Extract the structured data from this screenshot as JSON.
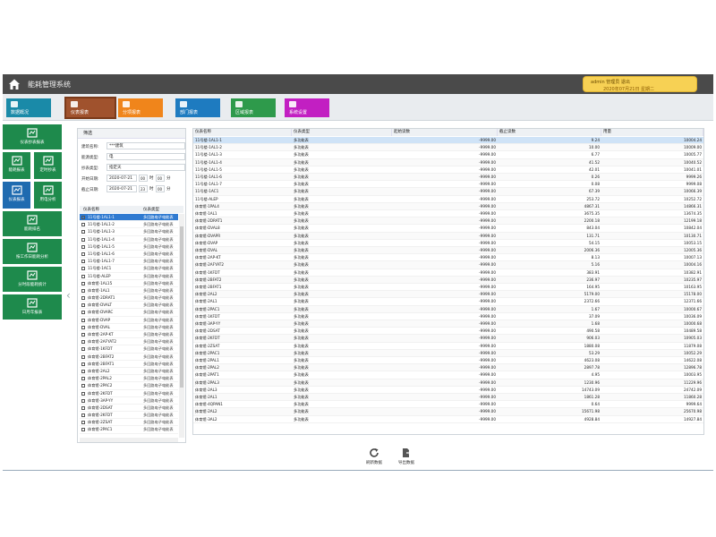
{
  "header": {
    "title": "能耗管理系统",
    "user_line": "admin 管理员  退出",
    "date_line": "2020年07月21日 星期二"
  },
  "tabs": [
    {
      "label": "数据概况",
      "color": "#1a8aa8"
    },
    {
      "label": "仪表报表",
      "color": "#a0522d"
    },
    {
      "label": "分项报表",
      "color": "#f0851b"
    },
    {
      "label": "部门报表",
      "color": "#1e7bc0"
    },
    {
      "label": "区域报表",
      "color": "#2e9a4b"
    },
    {
      "label": "系统设置",
      "color": "#c21fc2"
    }
  ],
  "leftnav": [
    {
      "label": "仪表抄表报表",
      "icon": "book-icon"
    },
    {
      "label": "能耗报表",
      "icon": "chart-icon"
    },
    {
      "label": "定时抄表",
      "icon": "clock-icon"
    },
    {
      "label": "仪表报表",
      "icon": "meter-icon"
    },
    {
      "label": "用电分析",
      "icon": "doc-icon"
    },
    {
      "label": "能耗排名",
      "icon": "rank-icon"
    },
    {
      "label": "按工作日能耗分析",
      "icon": "calendar-icon"
    },
    {
      "label": "分时段能耗统计",
      "icon": "target-icon"
    },
    {
      "label": "日月年报表",
      "icon": "sheet-icon"
    }
  ],
  "filter": {
    "title": "筛选",
    "fields": [
      {
        "label": "建筑名称:",
        "value": "***建筑"
      },
      {
        "label": "能源类型:",
        "value": "电"
      },
      {
        "label": "抄表类型:",
        "value": "指定天"
      },
      {
        "label": "开始日期:",
        "value": "2020-07-21"
      },
      {
        "label": "截止日期:",
        "value": "2020-07-21"
      }
    ],
    "time_hour_start": "00",
    "time_min_start": "00",
    "time_hour_end": "23",
    "time_min_end": "00",
    "time_unit_h": "时",
    "time_unit_m": "分",
    "col_name": "仪表名称",
    "col_type": "仪表类型",
    "items": [
      "11号楼-1AL1-1",
      "11号楼-1AL1-2",
      "11号楼-1AL1-3",
      "11号楼-1AL1-4",
      "11号楼-1AL1-5",
      "11号楼-1AL1-6",
      "11号楼-1AL1-7",
      "11号楼-1AC1",
      "11号楼-ALEP",
      "体育馆-1AL15",
      "体育馆-1AL1",
      "体育馆-2DRAT1",
      "体育馆-DVALT",
      "体育馆-DVARC",
      "体育馆-DVAP",
      "体育馆-DVAL",
      "体育馆-2AP-KT",
      "体育馆-2AFYAT2",
      "体育馆-1KFDT",
      "体育馆-2BFAT2",
      "体育馆-2BFAT1",
      "体育馆-2AL2",
      "体育馆-2PAL2",
      "体育馆-2PAC2",
      "体育馆-2KFDT",
      "体育馆-3AP-YY",
      "体育馆-2DSAT",
      "体育馆-2KFDT",
      "体育馆-2ZSAT",
      "体育馆-2PAC1"
    ],
    "item_type": "多回路电子电能表"
  },
  "grid": {
    "columns": [
      "仪表名称",
      "仪表类型",
      "起始读数",
      "截止读数",
      "用量"
    ],
    "type_value": "多功能表",
    "rows": [
      [
        "11号楼-1AL1-1",
        "-9999.00",
        "9.24",
        "10004.24"
      ],
      [
        "11号楼-1AL1-2",
        "-9999.00",
        "10.00",
        "10009.00"
      ],
      [
        "11号楼-1AL1-3",
        "-9999.00",
        "6.77",
        "10005.77"
      ],
      [
        "11号楼-1AL1-4",
        "-9999.00",
        "41.52",
        "10040.52"
      ],
      [
        "11号楼-1AL1-5",
        "-9999.00",
        "42.01",
        "10041.01"
      ],
      [
        "11号楼-1AL1-6",
        "-9999.00",
        "0.26",
        "9999.26"
      ],
      [
        "11号楼-1AL1-7",
        "-9999.00",
        "0.08",
        "9999.08"
      ],
      [
        "11号楼-1AC1",
        "-9999.00",
        "67.39",
        "10066.39"
      ],
      [
        "11号楼-ALEP",
        "-9999.00",
        "253.72",
        "10252.72"
      ],
      [
        "体育馆-1PAL4",
        "-9999.00",
        "4867.31",
        "14866.31"
      ],
      [
        "体育馆-1AL1",
        "-9999.00",
        "3675.35",
        "13674.35"
      ],
      [
        "体育馆-2DRAT1",
        "-9999.00",
        "2200.18",
        "12199.18"
      ],
      [
        "体育馆-DVAL8",
        "-9999.00",
        "843.04",
        "10842.04"
      ],
      [
        "体育馆-DVAPR",
        "-9999.00",
        "131.71",
        "10130.71"
      ],
      [
        "体育馆-DVAP",
        "-9999.00",
        "54.15",
        "10053.15"
      ],
      [
        "体育馆-DVAL",
        "-9999.00",
        "2006.36",
        "12005.36"
      ],
      [
        "体育馆-2AP-KT",
        "-9999.00",
        "8.13",
        "10007.13"
      ],
      [
        "体育馆-2AFYAT2",
        "-9999.00",
        "5.16",
        "10004.16"
      ],
      [
        "体育馆-1KFDT",
        "-9999.00",
        "383.91",
        "10382.91"
      ],
      [
        "体育馆-2BFAT2",
        "-9999.00",
        "236.97",
        "10235.97"
      ],
      [
        "体育馆-2BFAT1",
        "-9999.00",
        "164.95",
        "10163.95"
      ],
      [
        "体育馆-2AL2",
        "-9999.00",
        "5179.00",
        "15178.00"
      ],
      [
        "体育馆-2AL1",
        "-9999.00",
        "2372.66",
        "12371.66"
      ],
      [
        "体育馆-2PAC1",
        "-9999.00",
        "1.67",
        "10000.67"
      ],
      [
        "体育馆-1KFDT",
        "-9999.00",
        "37.09",
        "10036.09"
      ],
      [
        "体育馆-3AP-YY",
        "-9999.00",
        "1.68",
        "10000.68"
      ],
      [
        "体育馆-2DSAT",
        "-9999.00",
        "490.58",
        "10489.58"
      ],
      [
        "体育馆-2KFDT",
        "-9999.00",
        "906.03",
        "10905.03"
      ],
      [
        "体育馆-2ZSAT",
        "-9999.00",
        "1880.08",
        "11879.08"
      ],
      [
        "体育馆-2PAC1",
        "-9999.00",
        "53.29",
        "10052.29"
      ],
      [
        "体育馆-2PAL1",
        "-9999.00",
        "4623.08",
        "14622.08"
      ],
      [
        "体育馆-2PAL2",
        "-9999.00",
        "2897.78",
        "12896.78"
      ],
      [
        "体育馆-2PAT1",
        "-9999.00",
        "4.95",
        "10003.95"
      ],
      [
        "体育馆-2PAL3",
        "-9999.00",
        "1230.96",
        "11229.96"
      ],
      [
        "体育馆-2AL3",
        "-9999.00",
        "14743.09",
        "24742.09"
      ],
      [
        "体育馆-2AL1",
        "-9999.00",
        "1861.28",
        "11860.28"
      ],
      [
        "体育馆-4QPAN1",
        "-9999.00",
        "0.64",
        "9999.64"
      ],
      [
        "体育馆-2AL2",
        "-9999.00",
        "15671.98",
        "25670.98"
      ],
      [
        "体育馆-3AL2",
        "-9999.00",
        "4928.84",
        "14927.84"
      ]
    ]
  },
  "actions": {
    "refresh": "刷新数据",
    "export": "导出数据"
  },
  "collapse": "‹"
}
